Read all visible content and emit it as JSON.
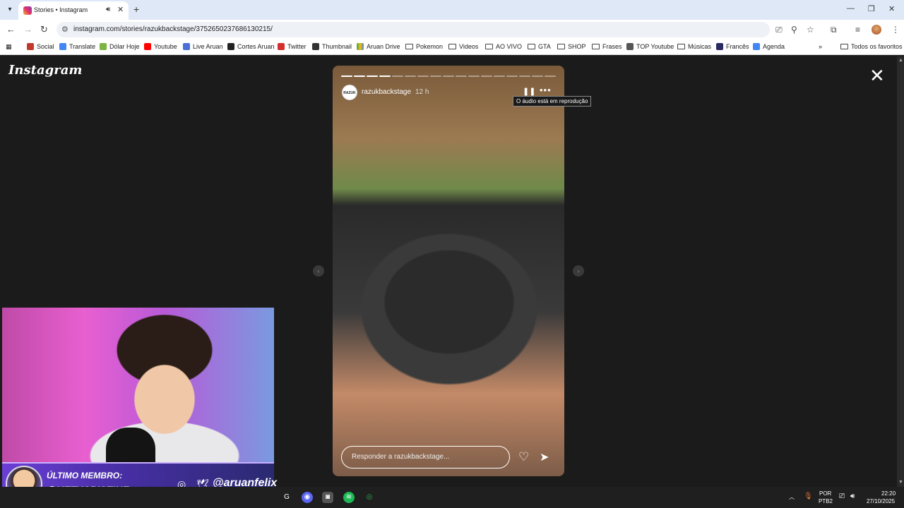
{
  "browser": {
    "tab_title": "Stories • Instagram",
    "url": "instagram.com/stories/razukbackstage/3752650237686130215/",
    "bookmarks": [
      "Social",
      "Translate",
      "Dólar Hoje",
      "Youtube",
      "Live Aruan",
      "Cortes Aruan",
      "Twitter",
      "Thumbnail",
      "Aruan Drive",
      "Pokemon",
      "Videos",
      "AO VIVO",
      "GTA",
      "SHOP",
      "Frases",
      "TOP Youtube",
      "Músicas",
      "Francês",
      "Agenda"
    ],
    "bookmarks_more": "»",
    "all_bookmarks": "Todos os favoritos"
  },
  "instagram": {
    "logo": "Instagram",
    "story": {
      "username": "razukbackstage",
      "time": "12 h",
      "avatar_text": "RAZUK",
      "tooltip": "O áudio está em reprodução",
      "reply_placeholder": "Responder a razukbackstage...",
      "progress_total": 17,
      "progress_done": 4
    }
  },
  "overlay": {
    "last_member_label": "ÚLTIMO MEMBRO:",
    "last_member": "@KETYCRISTINE",
    "handle": "@aruanfelix"
  },
  "taskbar": {
    "lang1": "POR",
    "lang2": "PTB2",
    "time": "22:20",
    "date": "27/10/2025"
  },
  "icons": {
    "close": "✕",
    "pause": "❚❚",
    "more": "•••",
    "heart": "♡",
    "send": "➤",
    "back": "←",
    "forward": "→",
    "reload": "↻",
    "star": "☆",
    "zoom": "⚲"
  }
}
